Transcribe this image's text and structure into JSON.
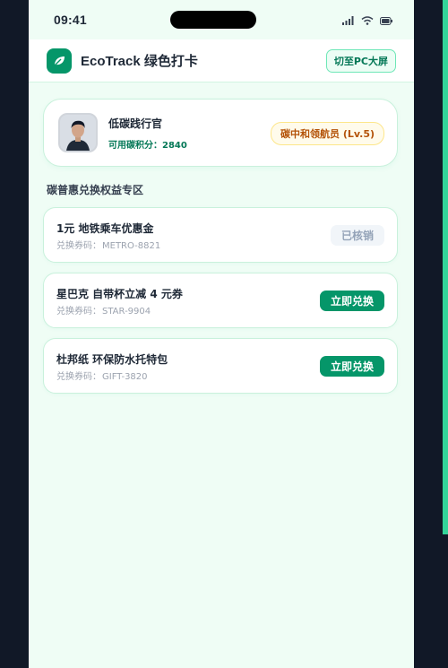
{
  "status_bar": {
    "time": "09:41"
  },
  "header": {
    "title": "EcoTrack 绿色打卡",
    "switch_button": "切至PC大屏",
    "logo_icon": "leaf-icon"
  },
  "profile": {
    "name": "低碳践行官",
    "points_label": "可用碳积分：",
    "points_value": "2840",
    "level": "碳中和领航员 (Lv.5)"
  },
  "section": {
    "title": "碳普惠兑换权益专区"
  },
  "rewards": [
    {
      "title": "1元 地铁乘车优惠金",
      "code_label": "兑换券码：",
      "code": "METRO-8821",
      "action": "已核销",
      "status": "used"
    },
    {
      "title": "星巴克 自带杯立减 4 元券",
      "code_label": "兑换券码：",
      "code": "STAR-9904",
      "action": "立即兑换",
      "status": "available"
    },
    {
      "title": "杜邦纸 环保防水托特包",
      "code_label": "兑换券码：",
      "code": "GIFT-3820",
      "action": "立即兑换",
      "status": "available"
    }
  ],
  "colors": {
    "brand_green": "#059669",
    "page_bg": "#effdf5",
    "level_badge": "#b45309"
  }
}
